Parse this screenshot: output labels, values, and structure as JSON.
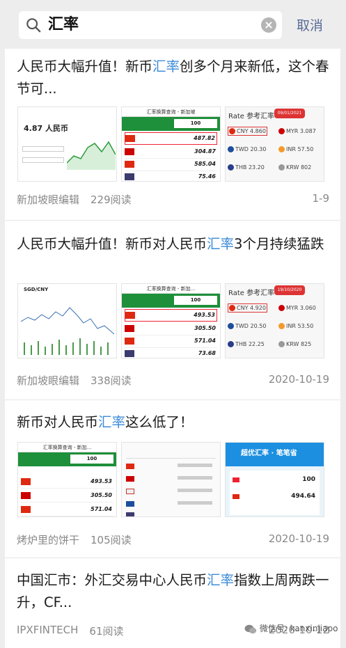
{
  "search": {
    "query": "汇率",
    "cancel_label": "取消"
  },
  "results": [
    {
      "title_pre": "人民币大幅升值！新币",
      "title_hl": "汇率",
      "title_post": "创多个月来新低，这个春节可...",
      "source": "新加坡眼编辑",
      "reads": "229阅读",
      "date": "1-9"
    },
    {
      "title_pre": "人民币大幅升值！新币对人民币",
      "title_hl": "汇率",
      "title_post": "3个月持续猛跌",
      "source": "新加坡眼编辑",
      "reads": "338阅读",
      "date": "2020-10-19"
    },
    {
      "title_pre": "新币对人民币",
      "title_hl": "汇率",
      "title_post": "这么低了！",
      "source": "烤炉里的饼干",
      "reads": "105阅读",
      "date": "2020-10-19"
    },
    {
      "title_pre": "中国汇市：外汇交易中心人民币",
      "title_hl": "汇率",
      "title_post": "指数上周两跌一升，CF...",
      "source": "IPXFINTECH",
      "reads": "61阅读",
      "date": "2020-10-12"
    }
  ],
  "thumbs": {
    "t1a": {
      "big": "4.87 人民币"
    },
    "t1b": {
      "hdr": "汇率换算查询 - 新加坡",
      "box": "100",
      "r1": "487.82",
      "r2": "304.87",
      "r3": "585.04",
      "r4": "75.46"
    },
    "t1c": {
      "ttl": "Rate 参考汇率",
      "badge": "09/01/2021",
      "c1": "CNY",
      "v1": "4.860",
      "c2": "MYR",
      "v2": "3.087",
      "c3": "TWD",
      "v3": "20.30",
      "c4": "INR",
      "v4": "57.50",
      "c5": "THB",
      "v5": "23.20",
      "c6": "KRW",
      "v6": "802"
    },
    "t2a": {
      "big": "SGD/CNY"
    },
    "t2b": {
      "hdr": "汇率换算查询 - 新加...",
      "box": "100",
      "r1": "493.53",
      "r2": "305.50",
      "r3": "571.04",
      "r4": "73.68"
    },
    "t2c": {
      "ttl": "Rate 参考汇率",
      "badge": "19/10/2020",
      "c1": "CNY",
      "v1": "4.920",
      "c2": "MYR",
      "v2": "3.060",
      "c3": "TWD",
      "v3": "20.50",
      "c4": "INR",
      "v4": "53.50",
      "c5": "THB",
      "v5": "22.25",
      "c6": "KRW",
      "v6": "825"
    },
    "t3a": {
      "hdr": "汇率换算查询 - 新加...",
      "box": "100",
      "r1": "493.53",
      "r2": "305.50",
      "r3": "571.04"
    },
    "t3c": {
      "top": "超优汇率 · 笔笔省",
      "v1": "100",
      "v2": "494.64"
    }
  },
  "watermark": "微信号: kanxinjiapo"
}
